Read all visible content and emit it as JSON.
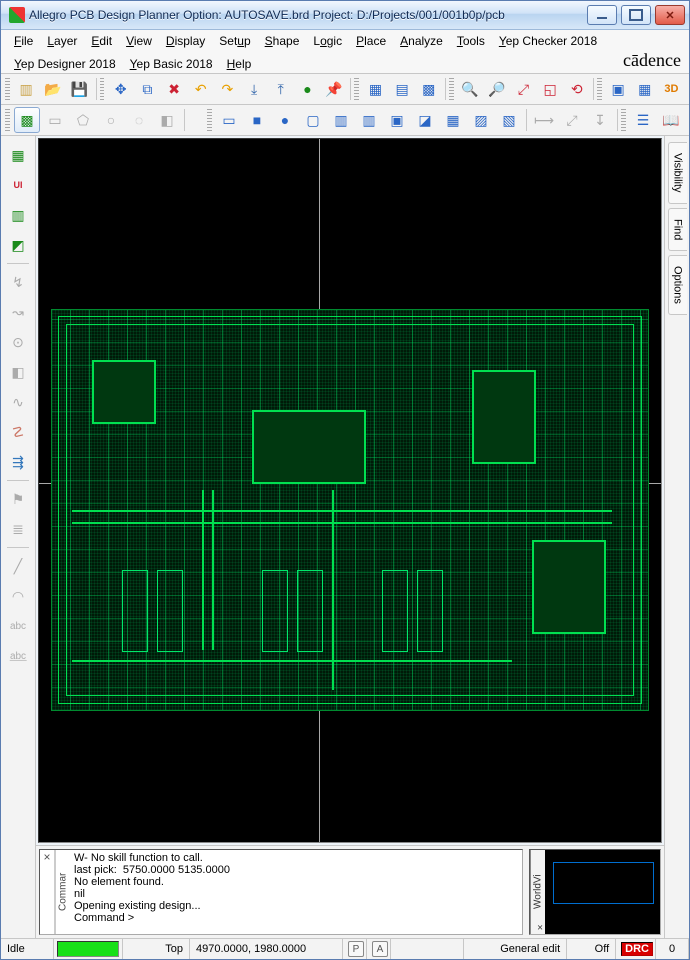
{
  "title": "Allegro PCB Design Planner Option: AUTOSAVE.brd  Project: D:/Projects/001/001b0p/pcb",
  "menus_row1": [
    "File",
    "Layer",
    "Edit",
    "View",
    "Display",
    "Setup",
    "Shape",
    "Logic",
    "Place",
    "Analyze",
    "Tools",
    "Yep Checker 2018"
  ],
  "menus_row2": [
    "Yep Designer 2018",
    "Yep Basic 2018",
    "Help"
  ],
  "brand": "cādence",
  "right_tabs": [
    "Visibility",
    "Find",
    "Options"
  ],
  "console_label": "Commar",
  "console_lines": "W- No skill function to call.\nlast pick:  5750.0000 5135.0000\nNo element found.\nnil\nOpening existing design...\nCommand >",
  "worldview_label": "WorldVi",
  "status": {
    "idle": "Idle",
    "layer": "Top",
    "coords": "4970.0000, 1980.0000",
    "mode": "General edit",
    "off": "Off",
    "drc": "DRC",
    "count": "0"
  }
}
